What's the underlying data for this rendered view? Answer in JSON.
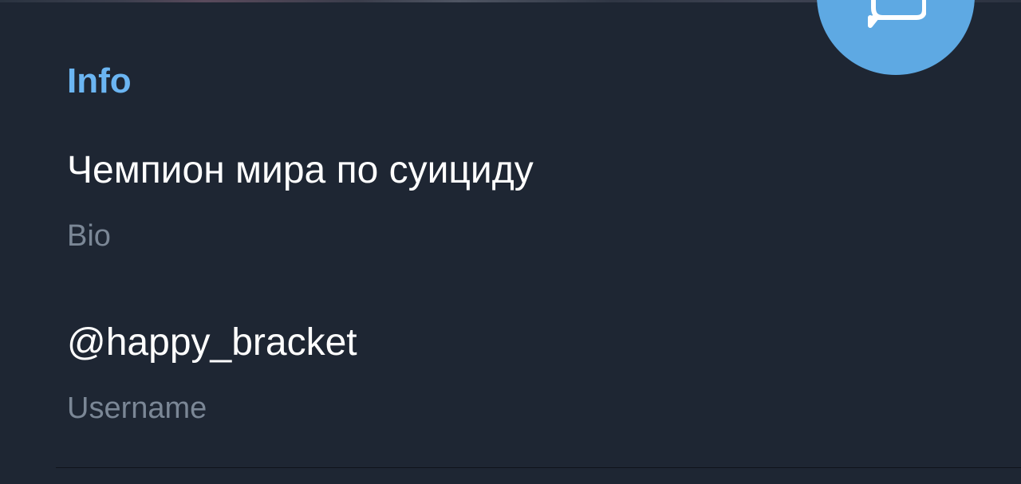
{
  "info": {
    "title": "Info",
    "bio": {
      "value": "Чемпион мира по суициду",
      "label": "Bio"
    },
    "username": {
      "value": "@happy_bracket",
      "label": "Username"
    }
  },
  "fab": {
    "icon": "message-icon"
  },
  "colors": {
    "background": "#1e2633",
    "accent": "#6bb5f2",
    "fab": "#5ea9e3",
    "primary_text": "#ffffff",
    "secondary_text": "#7b8796"
  }
}
